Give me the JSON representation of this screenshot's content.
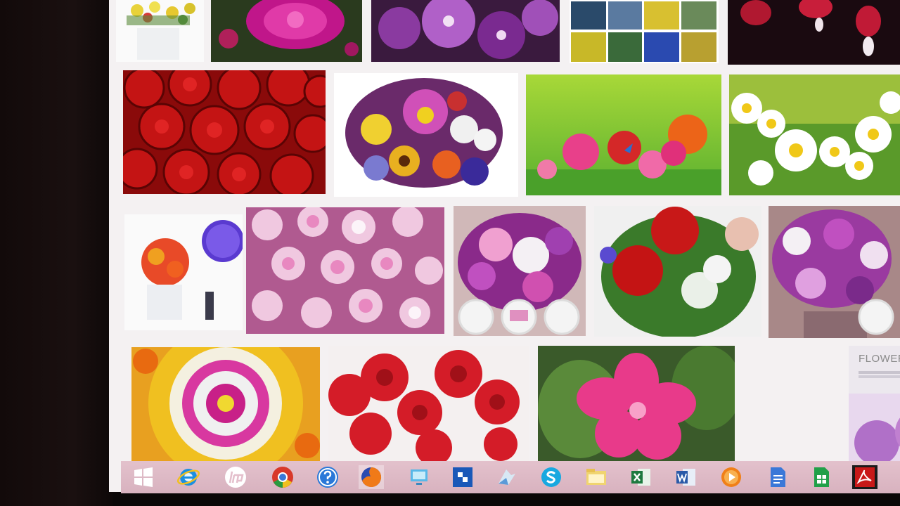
{
  "gallery": {
    "promo_card": {
      "title": "FLOWERS BY POST",
      "chevron": "›"
    }
  },
  "taskbar": {
    "icons": [
      "windows-start-icon",
      "internet-explorer-icon",
      "hp-icon",
      "chrome-icon",
      "help-icon",
      "firefox-icon",
      "remote-desktop-icon",
      "app-blue-icon",
      "app-bird-icon",
      "skype-icon",
      "file-explorer-icon",
      "excel-icon",
      "word-icon",
      "media-player-icon",
      "google-docs-icon",
      "google-sheets-icon",
      "acrobat-icon"
    ]
  },
  "colors": {
    "taskbar": "#dcb8c4",
    "screen_bg": "#f4f1f2"
  }
}
